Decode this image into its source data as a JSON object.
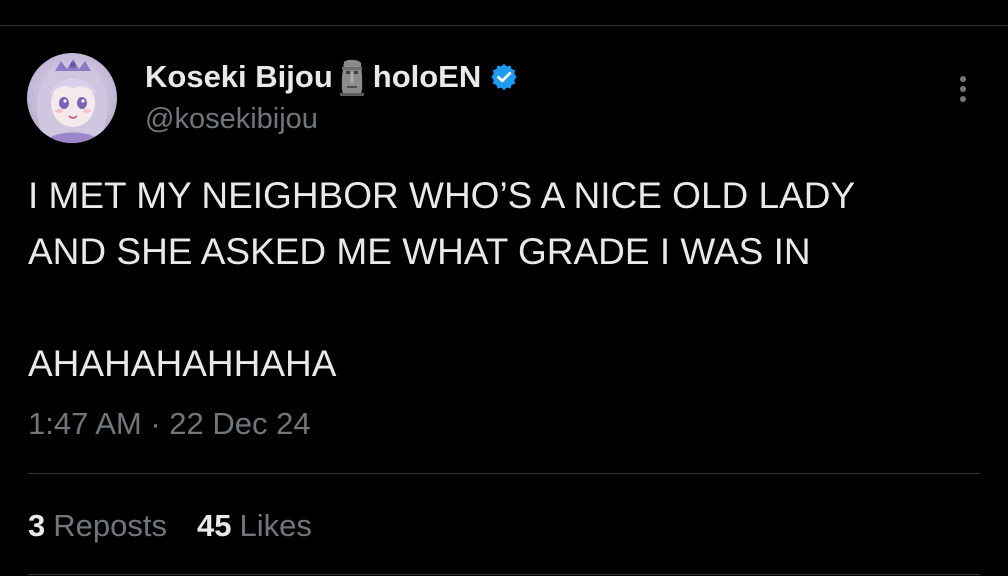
{
  "author": {
    "display_name": "Koseki Bijou",
    "display_suffix": "holoEN",
    "handle": "@kosekibijou",
    "emoji_icon": "moai-icon",
    "badge_icon": "verified-badge-icon",
    "badge_color": "#1d9bf0"
  },
  "tweet": {
    "text": "I MET MY NEIGHBOR WHO’S A NICE OLD LADY\nAND SHE ASKED ME WHAT GRADE I WAS IN\n\nAHAHAHAHHAHA",
    "timestamp": "1:47 AM · 22 Dec 24"
  },
  "stats": {
    "reposts_count": "3",
    "reposts_label": "Reposts",
    "likes_count": "45",
    "likes_label": "Likes"
  },
  "menu": {
    "icon": "more-options-icon"
  },
  "colors": {
    "background": "#000000",
    "text_primary": "#e7e9ea",
    "text_secondary": "#71767b",
    "divider": "#2f3336"
  }
}
